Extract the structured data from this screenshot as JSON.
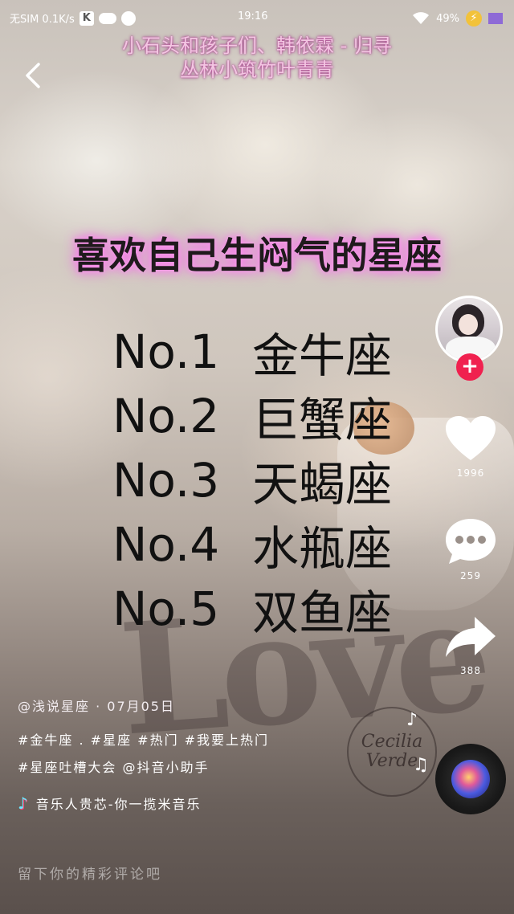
{
  "status_bar": {
    "carrier": "无SIM 0.1K/s",
    "k_badge": "K",
    "time": "19:16",
    "battery": "49%"
  },
  "song_header": {
    "line1": "小石头和孩子们、韩依霖 - 归寻",
    "line2": "丛林小筑竹叶青青"
  },
  "video": {
    "title": "喜欢自己生闷气的星座",
    "ranking": [
      {
        "no": "No.1",
        "sign": "金牛座"
      },
      {
        "no": "No.2",
        "sign": "巨蟹座"
      },
      {
        "no": "No.3",
        "sign": "天蝎座"
      },
      {
        "no": "No.4",
        "sign": "水瓶座"
      },
      {
        "no": "No.5",
        "sign": "双鱼座"
      }
    ]
  },
  "actions": {
    "follow": "+",
    "likes": "1996",
    "comments": "259",
    "shares": "388"
  },
  "stamp": {
    "line1": "Cecilia",
    "line2": "Verde"
  },
  "info": {
    "author": "@浅说星座 · 07月05日",
    "tags_line1": "#金牛座 . #星座 #热门 #我要上热门",
    "tags_line2": "#星座吐槽大会 @抖音小助手",
    "music": "音乐人贵芯-你一揽米音乐"
  },
  "comment_hint": "留下你的精彩评论吧",
  "colors": {
    "follow_red": "#f0214f",
    "song_title_pink": "#f3c6e2",
    "title_glow": "#f47be6"
  }
}
